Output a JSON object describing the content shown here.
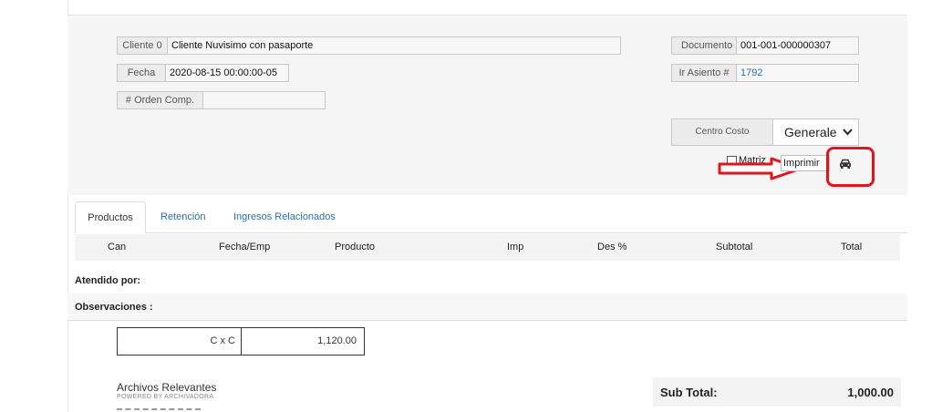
{
  "header": {
    "cliente_label": "Cliente 0",
    "cliente_value": "Cliente Nuvisimo con pasaporte",
    "fecha_label": "Fecha",
    "fecha_value": "2020-08-15 00:00:00-05",
    "orden_label": "# Orden Comp.",
    "orden_value": "",
    "documento_label": "Documento N",
    "documento_value": "001-001-000000307",
    "asiento_label": "Ir Asiento #",
    "asiento_value": "1792",
    "centro_costo_label": "Centro Costo",
    "centro_costo_value": "Generale",
    "matriz_label": "Matriz",
    "imprimir_label": "Imprimir"
  },
  "icons": {
    "car": "car-icon",
    "chevron": "chevron-down-icon",
    "annotation_arrow": "arrow-right-icon"
  },
  "tabs": [
    {
      "label": "Productos",
      "active": true
    },
    {
      "label": "Retención",
      "active": false
    },
    {
      "label": "Ingresos Relacionados",
      "active": false
    }
  ],
  "table": {
    "columns": [
      "Can",
      "Fecha/Emp",
      "Producto",
      "Imp",
      "Des %",
      "Subtotal",
      "Total"
    ]
  },
  "labels": {
    "atendido": "Atendido por:",
    "observaciones": "Observaciones :"
  },
  "cxc": {
    "label": "C x C",
    "value": "1,120.00"
  },
  "archivos": {
    "title": "Archivos Relevantes",
    "subtitle": "POWERED BY ARCHIVADORA"
  },
  "totals": {
    "subtotal_label": "Sub Total:",
    "subtotal_value": "1,000.00"
  },
  "colors": {
    "annotation": "#e0161e",
    "link": "#2a6fb0"
  }
}
